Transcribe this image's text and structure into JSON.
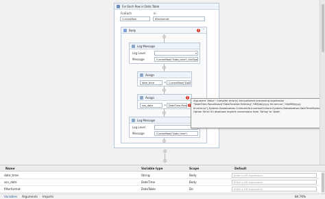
{
  "designer": {
    "foreach": {
      "title": "For Each Row in Data Table",
      "foreach_label": "ForEach",
      "in_label": "in",
      "foreach_value": "CurrentRow",
      "in_value": "filterformat"
    },
    "body": {
      "title": "Body"
    },
    "log1": {
      "title": "Log Message",
      "level_label": "Log Level",
      "message_label": "Message",
      "message_value": "CurrentRow(\"Date_time\").GetType"
    },
    "assign1": {
      "title": "Assign",
      "to_value": "date_time",
      "value_value": "CurrentRow(\"Date_"
    },
    "assign2": {
      "title": "Assign",
      "to_value": "ssn_date",
      "value_value": "DateTime.Parse"
    },
    "log2": {
      "title": "Log Message",
      "level_label": "Log Level",
      "message_label": "Message",
      "message_value": "CurrentRow(\"Date_time\")"
    },
    "warn_symbol": "!",
    "add_symbol": "+",
    "equals": "=",
    "collapse_symbol": "⌃",
    "tooltip": "Argument 'Value': Compiler error(s) encountered processing expression \"DateTime.ParseExact(\"DateTimeVar.ToString\",\"MM/dd/yyyy hh:mm:ss\",\"dd/MM/yyyy hh:mm:ss\"),System.Globalization.CultureInfo.InvariantCulture.System.Globalization.DateTimeStyles.None).ToString(\"dd/MM/yyyy\")\". Option Strict On disallows implicit conversions from 'String' to 'Date'."
  },
  "variables_panel": {
    "columns": [
      "Name",
      "Variable type",
      "Scope",
      "Default"
    ],
    "rows": [
      {
        "name": "date_time",
        "type": "String",
        "scope": "Body",
        "default": "Enter a VB expression"
      },
      {
        "name": "ssn_date",
        "type": "DateTime",
        "scope": "Body",
        "default": "Enter a VB expression"
      },
      {
        "name": "filterformat",
        "type": "DataTable",
        "scope": "Do",
        "default": "Enter a VB expression"
      }
    ]
  },
  "bottom_tabs": [
    "Variables",
    "Arguments",
    "Imports"
  ],
  "zoom": "84.76%",
  "colors": {
    "accent": "#2b5797",
    "error": "#d7311b",
    "activity_header": "#eef3f9"
  }
}
